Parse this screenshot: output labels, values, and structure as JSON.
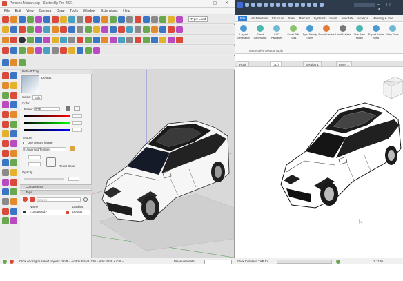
{
  "left_app": {
    "title": "Porsche Macan.skp - SketchUp Pro 2021",
    "menu": [
      "File",
      "Edit",
      "View",
      "Camera",
      "Draw",
      "Tools",
      "Window",
      "Extensions",
      "Help"
    ],
    "type_label": "Type: Load",
    "tray": {
      "header": "Default Tray",
      "section_tab": "Edit",
      "select_label": "Select",
      "color_label": "Color",
      "picker_label": "Picker:",
      "picker_value": "RGB",
      "texture_label": "Texture",
      "use_texture": "Use texture image",
      "texture_value": "(Unnamed Texture)",
      "reset_color": "Reset Color",
      "opacity_label": "Opacity",
      "components_label": "Components",
      "tags_label": "Tags",
      "search_placeholder": "Search",
      "tags_columns": [
        "Name",
        "Dashes"
      ],
      "tag_row_name": "Untagged",
      "tag_row_dash": "Default",
      "material_name": "<Untagged>"
    },
    "status": {
      "hint": "Click or drag to select objects. Shift = Add/Subtract. Ctrl = Add. Shift + Ctrl = ...",
      "measurements": "Measurements"
    }
  },
  "right_app": {
    "ribbon_tabs": [
      "File",
      "Architecture",
      "Structure",
      "Steel",
      "Precast",
      "Systems",
      "Insert",
      "Annotate",
      "Analyze",
      "Massing & Site"
    ],
    "active_tab": "File",
    "ribbon_buttons": [
      {
        "label": "Layout Generation"
      },
      {
        "label": "Sheet Generation"
      },
      {
        "label": "CAD Packages"
      },
      {
        "label": "Excel Shtt Tools"
      },
      {
        "label": "Sync Family Types"
      },
      {
        "label": "Export Levels"
      },
      {
        "label": "Level Marker"
      },
      {
        "label": "Live Sync Model"
      },
      {
        "label": "Export Active View"
      },
      {
        "label": "Map Tools"
      }
    ],
    "panel_label": "Generative Design Tools",
    "view_tabs": [
      "Roof",
      "(3D)",
      "Section 1",
      "Level 1"
    ],
    "status": {
      "hint": "Click to select, TAB for...",
      "scale": "1 : 100"
    }
  },
  "colors": {
    "revit_title": "#2d3b4b",
    "revit_active_tab": "#2f7fd8",
    "sketchup_red": "#d4503a"
  }
}
